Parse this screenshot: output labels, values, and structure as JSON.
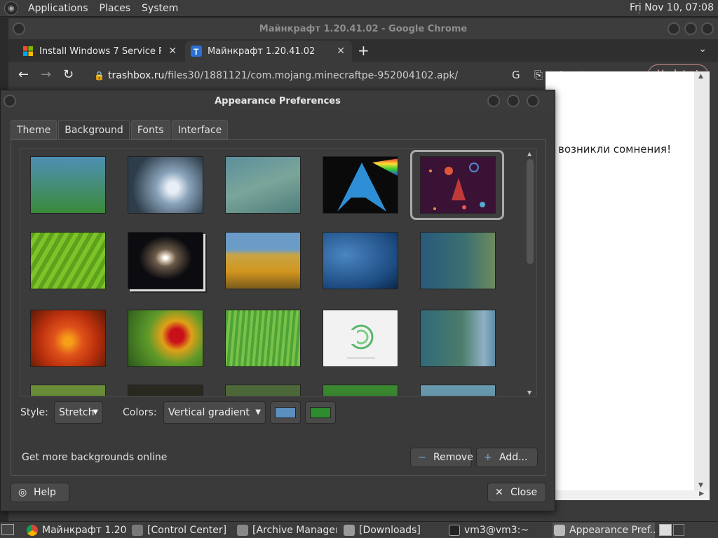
{
  "top_panel": {
    "menus": [
      "Applications",
      "Places",
      "System"
    ],
    "clock": "Fri Nov 10, 07:08"
  },
  "chrome": {
    "title": "Майнкрафт 1.20.41.02 - Google Chrome",
    "tabs": [
      {
        "label": "Install Windows 7 Service Pack",
        "favicon": "windows-logo-icon"
      },
      {
        "label": "Майнкрафт 1.20.41.02",
        "favicon": "trashbox-logo-icon"
      }
    ],
    "url_domain": "trashbox.ru",
    "url_path": "/files30/1881121/com.mojang.minecraftpe-952004102.apk/",
    "update_label": "Update",
    "page_text": "е возникли сомнения!"
  },
  "dialog": {
    "title": "Appearance Preferences",
    "tabs": [
      "Theme",
      "Background",
      "Fonts",
      "Interface"
    ],
    "active_tab": "Background",
    "style_label": "Style:",
    "style_value": "Stretch",
    "colors_label": "Colors:",
    "colors_value": "Vertical gradient",
    "primary_color": "#5b8fbf",
    "secondary_color": "#2e8b2e",
    "more_online": "Get more backgrounds online",
    "remove_label": "Remove",
    "add_label": "Add...",
    "help_label": "Help",
    "close_label": "Close",
    "selected_background_index": 4
  },
  "taskbar": {
    "items": [
      {
        "label": "Майнкрафт 1.20...",
        "icon": "chrome-icon"
      },
      {
        "label": "[Control Center]",
        "icon": "control-center-icon"
      },
      {
        "label": "[Archive Manager]",
        "icon": "archive-manager-icon"
      },
      {
        "label": "[Downloads]",
        "icon": "folder-icon"
      },
      {
        "label": "vm3@vm3:~",
        "icon": "terminal-icon"
      },
      {
        "label": "Appearance Pref...",
        "icon": "appearance-icon"
      }
    ]
  }
}
